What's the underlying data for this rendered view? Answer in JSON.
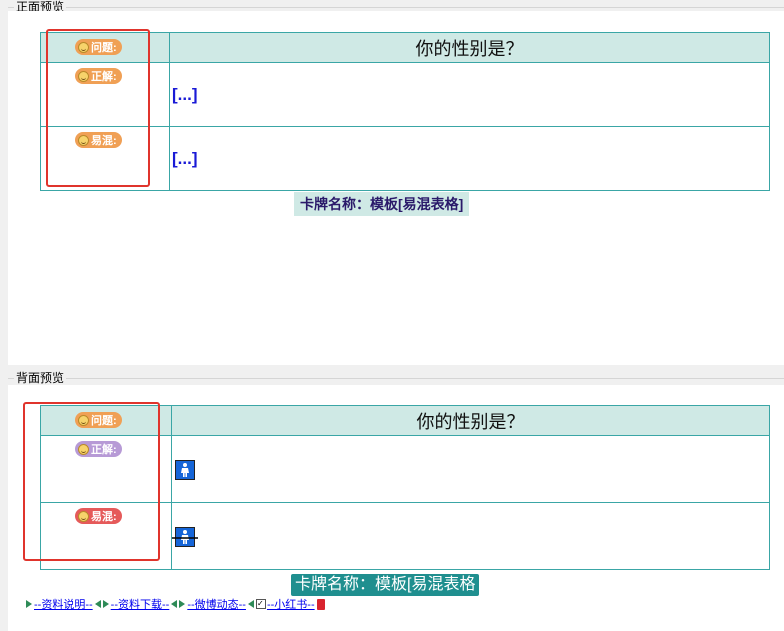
{
  "front": {
    "group_title": "正面预览",
    "question": "你的性别是？",
    "badge_question": "问题:",
    "badge_answer": "正解:",
    "badge_confuse": "易混:",
    "answer_text": "[...]",
    "confuse_text": "[...]",
    "card_name": "卡牌名称：模板[易混表格]"
  },
  "back": {
    "group_title": "背面预览",
    "question": "你的性别是？",
    "badge_question": "问题:",
    "badge_answer": "正解:",
    "badge_confuse": "易混:",
    "answer_icon": "female-restroom-icon",
    "confuse_icon": "female-restroom-strikethrough-icon",
    "card_name": "卡牌名称：模板[易混表格"
  },
  "footer_links": [
    {
      "label": "--资料说明--"
    },
    {
      "label": "--资料下载--"
    },
    {
      "label": "--微博动态--"
    },
    {
      "label": "--小红书--"
    }
  ],
  "colors": {
    "table_border": "#3aa6a6",
    "header_bg": "#cfe9e5",
    "badge_question": "#f0a055",
    "badge_answer_front": "#f0a055",
    "badge_answer_back": "#b79ad6",
    "badge_confuse_front": "#f0a055",
    "badge_confuse_back": "#e55a5a",
    "highlight_box": "#e0342c",
    "link": "#0000ee"
  }
}
